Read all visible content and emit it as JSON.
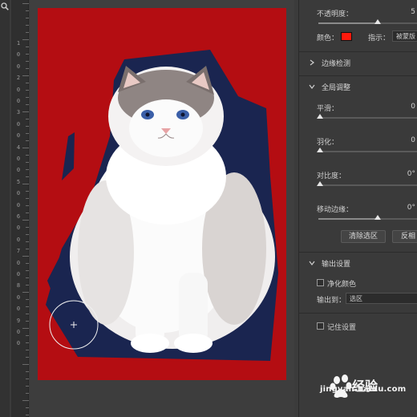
{
  "ruler": {
    "labels": [
      "1",
      "0",
      "0",
      "2",
      "0",
      "0",
      "3",
      "0",
      "0",
      "4",
      "0",
      "0",
      "5",
      "0",
      "0",
      "6",
      "0",
      "0",
      "7",
      "0",
      "0",
      "8",
      "0",
      "0",
      "9",
      "0",
      "0"
    ]
  },
  "panel": {
    "opacity_label": "不透明度：",
    "opacity_value": "5",
    "opacity_level": 0.6,
    "color_label": "颜色：",
    "color_hex": "#ff1a0d",
    "indicate_label": "指示：",
    "indicate_value": "被蒙版",
    "edge_detection_title": "边缘检测",
    "global_refine_title": "全局调整",
    "smooth_label": "平滑：",
    "smooth_value": "0",
    "feather_label": "羽化：",
    "feather_value": "0",
    "contrast_label": "对比度：",
    "contrast_value": "0°",
    "shift_edge_label": "移动边缘：",
    "shift_edge_value": "0°",
    "shift_edge_level": 0.6,
    "clear_selection_label": "清除选区",
    "invert_label": "反相",
    "output_settings_title": "输出设置",
    "decontaminate_label": "净化颜色",
    "output_to_label": "输出到：",
    "output_to_value": "选区",
    "remember_label": "记住设置"
  },
  "watermark": {
    "brand": "经验",
    "url": "jingyan.baidu.com"
  },
  "colors": {
    "canvas_red": "#b40d12",
    "overlay_navy": "#1a2550"
  }
}
